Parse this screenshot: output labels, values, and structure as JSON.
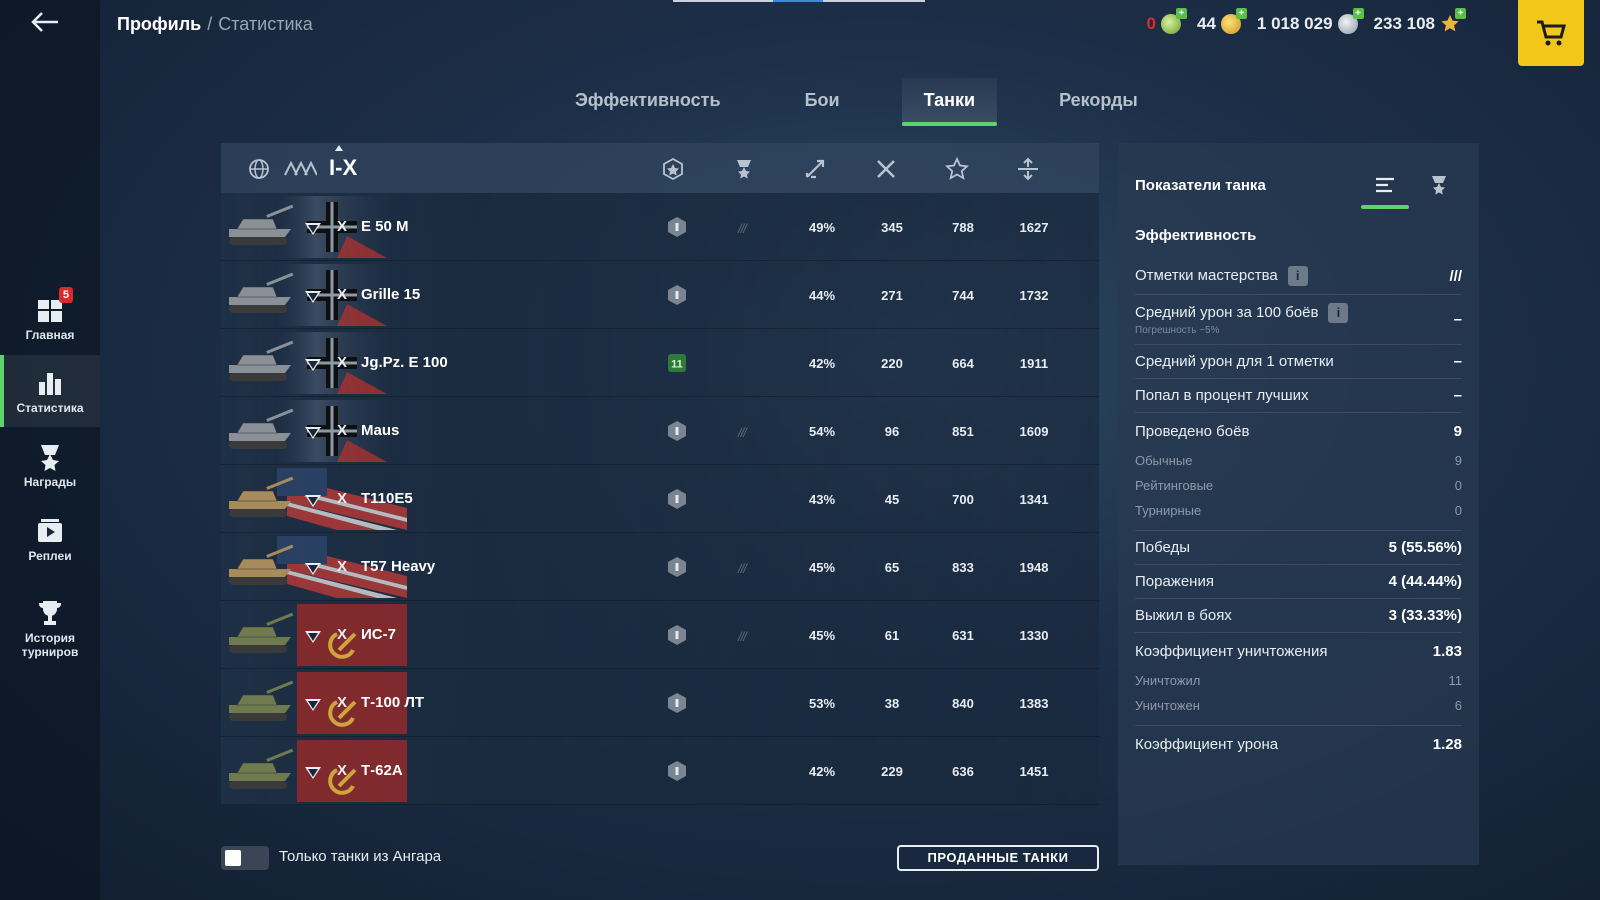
{
  "header": {
    "breadcrumb_current": "Профиль",
    "breadcrumb_separator": "/",
    "breadcrumb_sub": "Статистика",
    "currencies": [
      {
        "value": "0",
        "prefix_color": "#e02a2a",
        "icon": "free-xp-icon"
      },
      {
        "value": "44",
        "icon": "gold-icon"
      },
      {
        "value": "1 018 029",
        "icon": "credits-icon"
      },
      {
        "value": "233 108",
        "icon": "xp-star-icon"
      }
    ]
  },
  "sidebar": {
    "items": [
      {
        "label": "Главная",
        "icon": "home-icon",
        "badge": "5"
      },
      {
        "label": "Статистика",
        "icon": "stats-icon"
      },
      {
        "label": "Награды",
        "icon": "awards-icon"
      },
      {
        "label": "Реплеи",
        "icon": "replays-icon"
      },
      {
        "label": "История турниров",
        "icon": "trophy-icon"
      }
    ]
  },
  "tabs": [
    {
      "label": "Эффективность"
    },
    {
      "label": "Бои"
    },
    {
      "label": "Танки",
      "active": true
    },
    {
      "label": "Рекорды"
    }
  ],
  "table": {
    "tier_filter": "I-X",
    "column_icons": [
      "mastery-icon",
      "marks-icon",
      "winrate-icon",
      "battles-icon",
      "wn-icon",
      "damage-icon"
    ],
    "rows": [
      {
        "level": "X",
        "name": "E 50 M",
        "nation": "germany",
        "mastery": "",
        "mark": "///",
        "winrate": "49%",
        "battles": "345",
        "c5": "788",
        "c6": "1627"
      },
      {
        "level": "X",
        "name": "Grille 15",
        "nation": "germany",
        "mastery": "",
        "mark": "",
        "winrate": "44%",
        "battles": "271",
        "c5": "744",
        "c6": "1732"
      },
      {
        "level": "X",
        "name": "Jg.Pz. E 100",
        "nation": "germany",
        "mastery": "11",
        "mark": "",
        "winrate": "42%",
        "battles": "220",
        "c5": "664",
        "c6": "1911"
      },
      {
        "level": "X",
        "name": "Maus",
        "nation": "germany",
        "mastery": "",
        "mark": "///",
        "winrate": "54%",
        "battles": "96",
        "c5": "851",
        "c6": "1609"
      },
      {
        "level": "X",
        "name": "T110E5",
        "nation": "usa",
        "mastery": "",
        "mark": "",
        "winrate": "43%",
        "battles": "45",
        "c5": "700",
        "c6": "1341"
      },
      {
        "level": "X",
        "name": "T57 Heavy",
        "nation": "usa",
        "mastery": "",
        "mark": "///",
        "winrate": "45%",
        "battles": "65",
        "c5": "833",
        "c6": "1948"
      },
      {
        "level": "X",
        "name": "ИС-7",
        "nation": "ussr",
        "mastery": "",
        "mark": "///",
        "winrate": "45%",
        "battles": "61",
        "c5": "631",
        "c6": "1330"
      },
      {
        "level": "X",
        "name": "Т-100 ЛТ",
        "nation": "ussr",
        "mastery": "",
        "mark": "",
        "winrate": "53%",
        "battles": "38",
        "c5": "840",
        "c6": "1383"
      },
      {
        "level": "X",
        "name": "Т-62А",
        "nation": "ussr",
        "mastery": "",
        "mark": "",
        "winrate": "42%",
        "battles": "229",
        "c5": "636",
        "c6": "1451"
      }
    ]
  },
  "footer": {
    "toggle_label": "Только танки из Ангара",
    "sold_button": "ПРОДАННЫЕ ТАНКИ"
  },
  "panel": {
    "title": "Показатели танка",
    "section": "Эффективность",
    "rows": [
      {
        "label": "Отметки мастерства",
        "value": "///",
        "info": true,
        "kind": "main"
      },
      {
        "label": "Средний урон за 100 боёв",
        "value": "–",
        "info": true,
        "note": "Погрешность ~5%",
        "kind": "main"
      },
      {
        "label": "Средний урон для 1 отметки",
        "value": "–",
        "kind": "main"
      },
      {
        "label": "Попал в процент лучших",
        "value": "–",
        "kind": "main"
      },
      {
        "label": "Проведено боёв",
        "value": "9",
        "kind": "main-nodiv"
      },
      {
        "label": "Обычные",
        "value": "9",
        "kind": "sub"
      },
      {
        "label": "Рейтинговые",
        "value": "0",
        "kind": "sub"
      },
      {
        "label": "Турнирные",
        "value": "0",
        "kind": "sub-div"
      },
      {
        "label": "Победы",
        "value": "5 (55.56%)",
        "kind": "main"
      },
      {
        "label": "Поражения",
        "value": "4 (44.44%)",
        "kind": "main"
      },
      {
        "label": "Выжил в боях",
        "value": "3 (33.33%)",
        "kind": "main"
      },
      {
        "label": "Коэффициент уничтожения",
        "value": "1.83",
        "kind": "main-nodiv"
      },
      {
        "label": "Уничтожил",
        "value": "11",
        "kind": "sub"
      },
      {
        "label": "Уничтожен",
        "value": "6",
        "kind": "sub-div"
      },
      {
        "label": "Коэффициент урона",
        "value": "1.28",
        "kind": "main-nodiv"
      }
    ]
  },
  "colors": {
    "accent": "#5ed36a",
    "cart": "#f2c719",
    "badge": "#d9292b"
  }
}
